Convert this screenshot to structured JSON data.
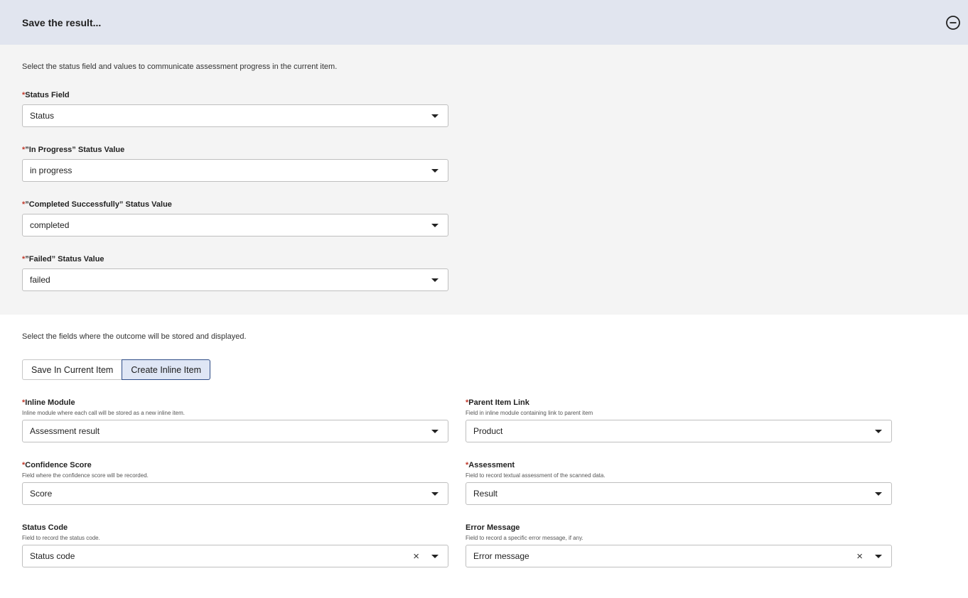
{
  "header": {
    "title": "Save the result..."
  },
  "status_section": {
    "description": "Select the status field and values to communicate assessment progress in the current item.",
    "fields": [
      {
        "label": "Status Field",
        "required": "*",
        "value": "Status"
      },
      {
        "label": "”In Progress” Status Value",
        "required": "*",
        "value": "in progress"
      },
      {
        "label": "”Completed Successfully” Status Value",
        "required": "*",
        "value": "completed"
      },
      {
        "label": "”Failed” Status Value",
        "required": "*",
        "value": "failed"
      }
    ]
  },
  "output_section": {
    "description": "Select the fields where the outcome will be stored and displayed.",
    "toggle": {
      "save_in_current": "Save In Current Item",
      "create_inline": "Create Inline Item",
      "selected": "Create Inline Item"
    },
    "fields": {
      "inline_module": {
        "required": "*",
        "label": "Inline Module",
        "hint": "Inline module where each call will be stored as a new inline item.",
        "value": "Assessment result"
      },
      "parent_link": {
        "required": "*",
        "label": "Parent Item Link",
        "hint": "Field in inline module containing link to parent item",
        "value": "Product"
      },
      "confidence": {
        "required": "*",
        "label": "Confidence Score",
        "hint": "Field where the confidence score will be recorded.",
        "value": "Score"
      },
      "assessment": {
        "required": "*",
        "label": "Assessment",
        "hint": "Field to record textual assessment of the scanned data.",
        "value": "Result"
      },
      "status_code": {
        "label": "Status Code",
        "hint": "Field to record the status code.",
        "value": "Status code",
        "clear": "×"
      },
      "error_message": {
        "label": "Error Message",
        "hint": "Field to record a specific error message, if any.",
        "value": "Error message",
        "clear": "×"
      }
    }
  },
  "icons": {
    "collapse": "minus-circle-icon",
    "dropdown": "caret-down-icon",
    "clear": "clear-x-icon"
  },
  "colors": {
    "header_bg": "#e1e5ef",
    "required": "#c0392b",
    "toggle_active_bg": "#dfe6f5",
    "toggle_active_border": "#2f4d87"
  }
}
